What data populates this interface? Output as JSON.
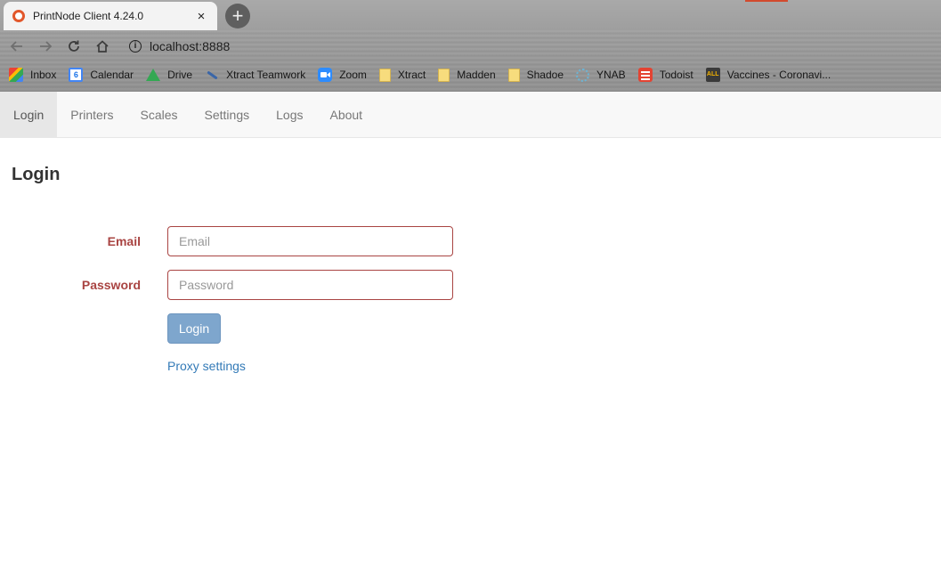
{
  "browser": {
    "tab_title": "PrintNode Client 4.24.0",
    "tab_close": "×",
    "new_tab": "+",
    "url": "localhost:8888",
    "bookmarks": [
      {
        "label": "Inbox",
        "icon": "gmail-icon"
      },
      {
        "label": "Calendar",
        "icon": "calendar-icon",
        "icon_text": "6"
      },
      {
        "label": "Drive",
        "icon": "drive-icon"
      },
      {
        "label": "Xtract Teamwork",
        "icon": "xtract-teamwork-icon"
      },
      {
        "label": "Zoom",
        "icon": "zoom-icon"
      },
      {
        "label": "Xtract",
        "icon": "folder-icon"
      },
      {
        "label": "Madden",
        "icon": "folder-icon"
      },
      {
        "label": "Shadoe",
        "icon": "folder-icon"
      },
      {
        "label": "YNAB",
        "icon": "ynab-icon"
      },
      {
        "label": "Todoist",
        "icon": "todoist-icon"
      },
      {
        "label": "Vaccines - Coronavi...",
        "icon": "vaccines-icon",
        "icon_text": "ALL"
      }
    ]
  },
  "nav": {
    "items": [
      {
        "label": "Login",
        "active": true
      },
      {
        "label": "Printers"
      },
      {
        "label": "Scales"
      },
      {
        "label": "Settings"
      },
      {
        "label": "Logs"
      },
      {
        "label": "About"
      }
    ]
  },
  "login": {
    "title": "Login",
    "email_label": "Email",
    "email_placeholder": "Email",
    "email_value": "",
    "password_label": "Password",
    "password_placeholder": "Password",
    "password_value": "",
    "submit_label": "Login",
    "proxy_link": "Proxy settings"
  },
  "colors": {
    "error": "#a94442",
    "button": "#7ea6cd",
    "link": "#337ab7"
  }
}
